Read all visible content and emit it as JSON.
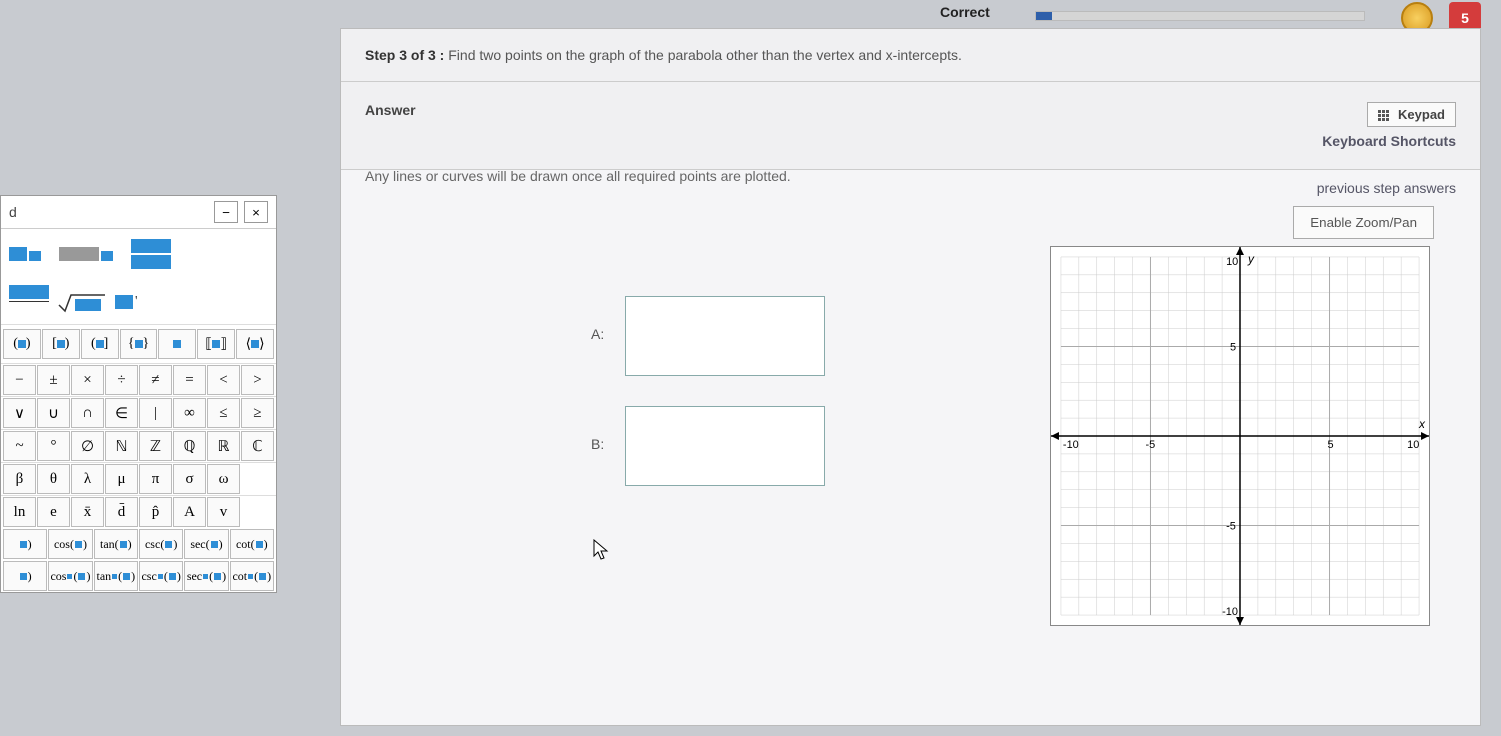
{
  "topbar": {
    "correct_label": "Correct",
    "count_badge": "5"
  },
  "step": {
    "prefix": "Step 3 of 3 :",
    "text": " Find two points on the graph of the parabola other than the vertex and x-intercepts."
  },
  "answer": {
    "label": "Answer",
    "keypad_btn": "Keypad",
    "shortcuts": "Keyboard Shortcuts",
    "prev_step": "previous step answers",
    "instruction": "Any lines or curves will be drawn once all required points are plotted.",
    "zoom_btn": "Enable Zoom/Pan"
  },
  "inputs": {
    "labelA": "A:",
    "labelB": "B:",
    "valueA": "",
    "valueB": ""
  },
  "graph": {
    "y_label": "y",
    "x_label": "x",
    "ticks": [
      "-10",
      "-5",
      "5",
      "10"
    ],
    "range": [
      -10,
      10
    ]
  },
  "keypad": {
    "title": "d",
    "minimize": "−",
    "close": "×",
    "ops_row1": [
      "−",
      "±",
      "×",
      "÷",
      "≠",
      "=",
      "<",
      ">"
    ],
    "ops_row2": [
      "∨",
      "∪",
      "∩",
      "∈",
      "|",
      "∞",
      "≤",
      "≥"
    ],
    "ops_row3": [
      "~",
      "°",
      "∅",
      "ℕ",
      "ℤ",
      "ℚ",
      "ℝ",
      "ℂ"
    ],
    "ops_row4": [
      "β",
      "θ",
      "λ",
      "μ",
      "π",
      "σ",
      "ω",
      ""
    ],
    "ops_row5": [
      "ln",
      "e",
      "x̄",
      "d̄",
      "p̂",
      "A",
      "v",
      ""
    ],
    "trig_row1": [
      "cos",
      "tan",
      "csc",
      "sec",
      "cot"
    ],
    "trig_row2": [
      "cos",
      "tan",
      "csc",
      "sec",
      "cot"
    ]
  },
  "chart_data": {
    "type": "scatter",
    "title": "",
    "xlabel": "x",
    "ylabel": "y",
    "xlim": [
      -10,
      10
    ],
    "ylim": [
      -10,
      10
    ],
    "xticks": [
      -10,
      -5,
      5,
      10
    ],
    "yticks": [
      -10,
      -5,
      5,
      10
    ],
    "series": []
  }
}
